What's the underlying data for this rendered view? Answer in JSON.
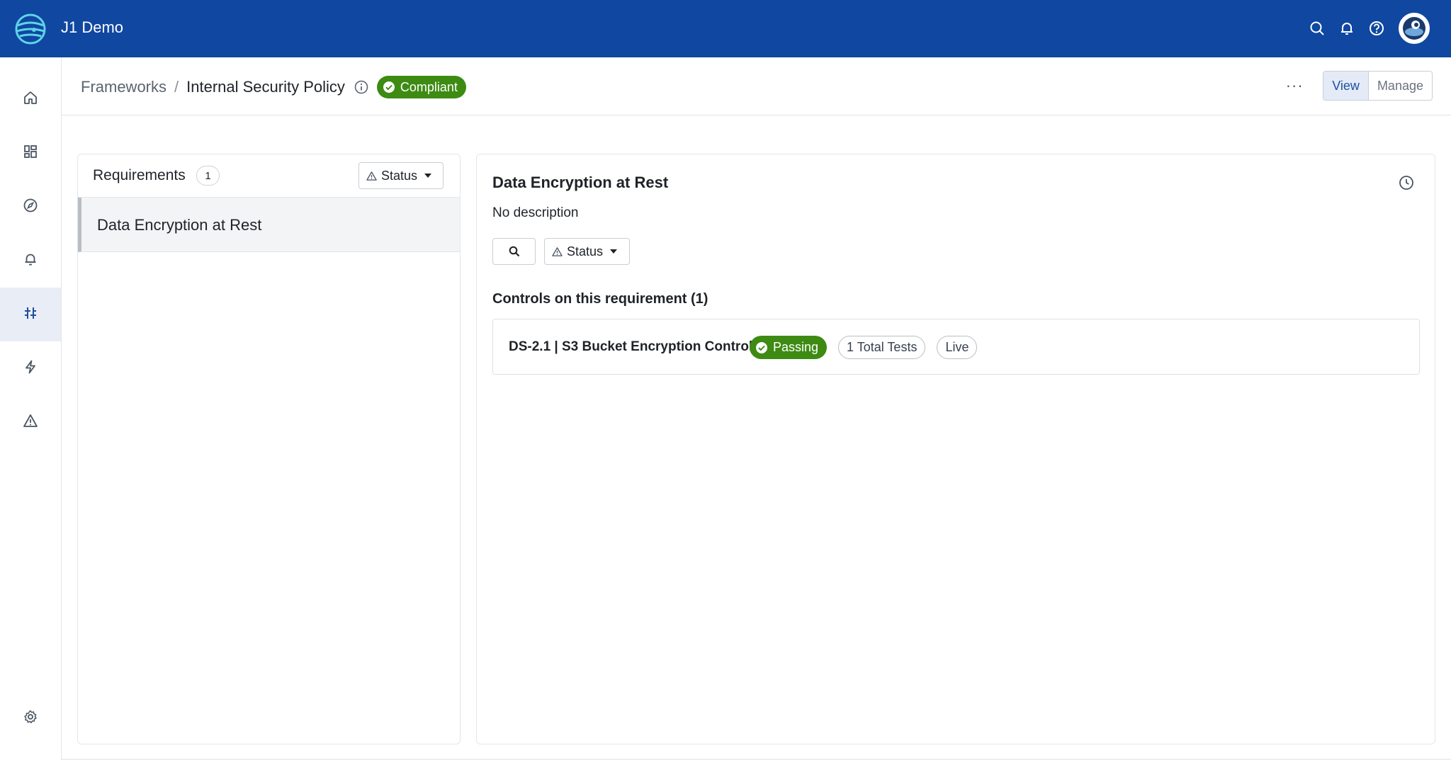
{
  "app": {
    "title": "J1 Demo"
  },
  "topbar": {
    "icons": [
      "search-icon",
      "bell-icon",
      "help-icon"
    ]
  },
  "leftnav": {
    "items": [
      {
        "name": "home-icon",
        "active": false
      },
      {
        "name": "dashboard-icon",
        "active": false
      },
      {
        "name": "compass-icon",
        "active": false
      },
      {
        "name": "bell-icon",
        "active": false
      },
      {
        "name": "compliance-icon",
        "active": true
      },
      {
        "name": "lightning-icon",
        "active": false
      },
      {
        "name": "warning-icon",
        "active": false
      },
      {
        "name": "settings-icon",
        "active": false
      }
    ]
  },
  "header": {
    "breadcrumb_root": "Frameworks",
    "breadcrumb_sep": "/",
    "framework_name": "Internal Security Policy",
    "status_badge": "Compliant",
    "more": "···",
    "view_label": "View",
    "manage_label": "Manage"
  },
  "requirements": {
    "title": "Requirements",
    "count": "1",
    "status_filter": "Status",
    "items": [
      {
        "label": "Data Encryption at Rest",
        "selected": true
      }
    ]
  },
  "detail": {
    "title": "Data Encryption at Rest",
    "description": "No description",
    "status_filter": "Status",
    "controls_title": "Controls on this requirement (1)",
    "controls": [
      {
        "name": "DS-2.1 | S3 Bucket Encryption Control",
        "status": "Passing",
        "tests": "1 Total Tests",
        "mode": "Live"
      }
    ]
  },
  "colors": {
    "topbar": "#0f47a1",
    "success": "#3d8b13",
    "nav_active": "#e8edf6"
  }
}
